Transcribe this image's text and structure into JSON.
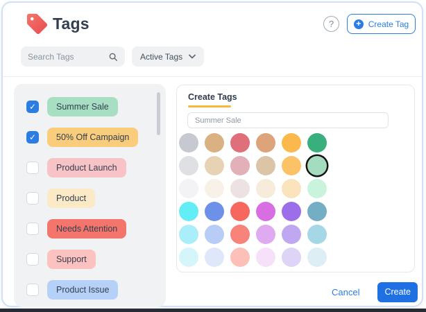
{
  "header": {
    "title": "Tags",
    "help_label": "?",
    "create_tag_label": "Create Tag"
  },
  "toolbar": {
    "search_placeholder": "Search Tags",
    "filter_value": "Active Tags"
  },
  "tag_list": {
    "items": [
      {
        "label": "Summer Sale",
        "checked": true,
        "chip_color": "#a8dfc3"
      },
      {
        "label": "50% Off Campaign",
        "checked": true,
        "chip_color": "#f9cd7c"
      },
      {
        "label": "Product Launch",
        "checked": false,
        "chip_color": "#f8c3c6"
      },
      {
        "label": "Product",
        "checked": false,
        "chip_color": "#fbeac5"
      },
      {
        "label": "Needs Attention",
        "checked": false,
        "chip_color": "#f4756c"
      },
      {
        "label": "Support",
        "checked": false,
        "chip_color": "#fbc2c0"
      },
      {
        "label": "Product Issue",
        "checked": false,
        "chip_color": "#b5d1f8"
      }
    ]
  },
  "create_panel": {
    "title": "Create Tags",
    "tag_name_value": "Summer Sale",
    "palette_rows": [
      [
        "#c6c9d2",
        "#d9b183",
        "#df6f7b",
        "#dda47c",
        "#fbb84c",
        "#3aaf7e"
      ],
      [
        "#dfe0e4",
        "#e8d2b4",
        "#e2b0b8",
        "#dcc5a6",
        "#fcc268",
        "#a5dcc0"
      ],
      [
        "#f3f3f5",
        "#f8f1e8",
        "#ece2e2",
        "#f7ecdc",
        "#fbe3bd",
        "#c9f3dd"
      ],
      [
        "#63eef5",
        "#6d91e8",
        "#f6685f",
        "#d76fe3",
        "#9d6ee9",
        "#74aec4"
      ],
      [
        "#a9eef8",
        "#b8cdf5",
        "#f8837a",
        "#e0aaf0",
        "#c0a8f0",
        "#a6d7e6"
      ],
      [
        "#d4f6fa",
        "#dfe7fb",
        "#fcc0b8",
        "#f6e0fa",
        "#ded4f6",
        "#ddeef4"
      ]
    ],
    "selected_swatch": {
      "row": 1,
      "col": 5
    },
    "cancel_label": "Cancel",
    "create_label": "Create"
  },
  "colors": {
    "accent_blue": "#2b7de2",
    "card_border": "#cfe0f8",
    "underline_amber": "#f6b93c",
    "tag_logo_red": "#ee5a56"
  }
}
